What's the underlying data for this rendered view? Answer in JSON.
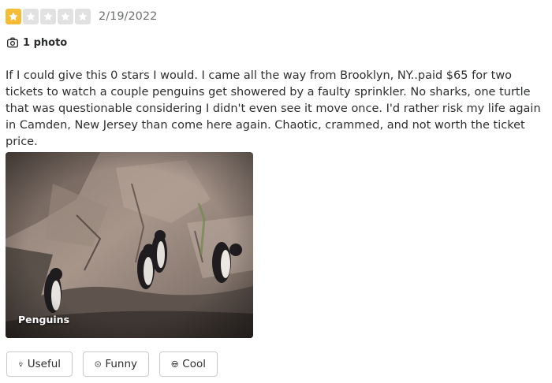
{
  "review": {
    "rating": 1,
    "max_rating": 5,
    "date": "2/19/2022",
    "photo_count_label": "1 photo",
    "text": "If I could give this 0 stars I would. I came all the way from Brooklyn, NY..paid $65 for two tickets to watch a couple penguins get showered by a faulty sprinkler. No sharks, one turtle that was questionable considering I didn't even see it move once. I'd rather risk my life again in Camden, New Jersey than come here again. Chaotic, crammed, and not worth the ticket price.",
    "photo": {
      "caption": "Penguins"
    }
  },
  "reactions": [
    {
      "label": "Useful",
      "icon": "lightbulb-icon"
    },
    {
      "label": "Funny",
      "icon": "smile-icon"
    },
    {
      "label": "Cool",
      "icon": "sunglasses-icon"
    }
  ],
  "colors": {
    "star_filled": "#f5bd36",
    "star_empty": "#e1e1e1",
    "text": "#2d2e2f",
    "muted": "#6e7072",
    "border": "#c8c9ca"
  }
}
